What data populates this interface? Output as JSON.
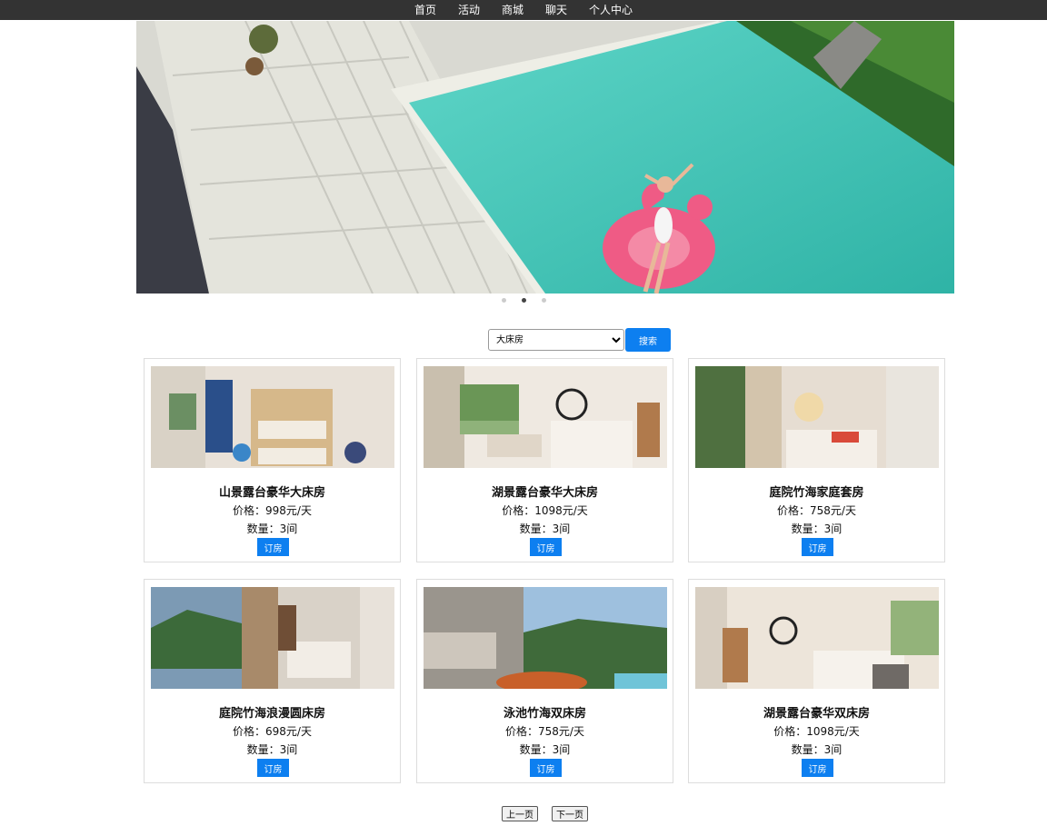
{
  "nav": {
    "items": [
      {
        "label": "首页"
      },
      {
        "label": "活动"
      },
      {
        "label": "商城"
      },
      {
        "label": "聊天"
      },
      {
        "label": "个人中心"
      }
    ]
  },
  "carousel": {
    "slides_count": 3,
    "active_index": 1
  },
  "search": {
    "selected": "大床房",
    "button_label": "搜索"
  },
  "rooms": [
    {
      "name": "山景露台豪华大床房",
      "price": "价格：998元/天",
      "qty": "数量：3间",
      "book": "订房"
    },
    {
      "name": "湖景露台豪华大床房",
      "price": "价格：1098元/天",
      "qty": "数量：3间",
      "book": "订房"
    },
    {
      "name": "庭院竹海家庭套房",
      "price": "价格：758元/天",
      "qty": "数量：3间",
      "book": "订房"
    },
    {
      "name": "庭院竹海浪漫圆床房",
      "price": "价格：698元/天",
      "qty": "数量：3间",
      "book": "订房"
    },
    {
      "name": "泳池竹海双床房",
      "price": "价格：758元/天",
      "qty": "数量：3间",
      "book": "订房"
    },
    {
      "name": "湖景露台豪华双床房",
      "price": "价格：1098元/天",
      "qty": "数量：3间",
      "book": "订房"
    }
  ],
  "pager": {
    "prev_label": "上一页",
    "next_label": "下一页"
  },
  "colors": {
    "nav_bg": "#333333",
    "accent": "#0d7ff0"
  }
}
